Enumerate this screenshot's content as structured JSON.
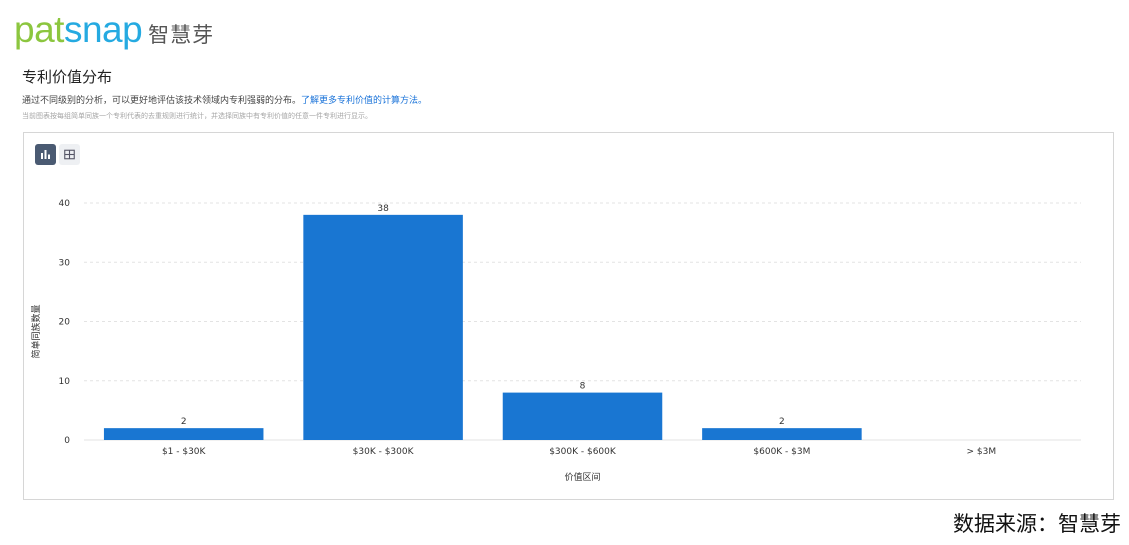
{
  "logo": {
    "word_a": "pat",
    "word_b": "snap",
    "cn": "智慧芽"
  },
  "header": {
    "title": "专利价值分布",
    "description": "通过不同级别的分析，可以更好地评估该技术领域内专利强弱的分布。",
    "description_link": "了解更多专利价值的计算方法。",
    "note": "当前图表按每组简单同族一个专利代表的去重规则进行统计，并选择同族中有专利价值的任意一件专利进行显示。"
  },
  "toolbar": {
    "chart_view": "bar-chart-icon",
    "table_view": "table-grid-icon",
    "active": "chart"
  },
  "colors": {
    "bar": "#1976d2",
    "grid": "#e3e3e3",
    "active_btn": "#4a5a72"
  },
  "chart_data": {
    "type": "bar",
    "categories": [
      "$1 - $30K",
      "$30K - $300K",
      "$300K - $600K",
      "$600K - $3M",
      "> $3M"
    ],
    "values": [
      2,
      38,
      8,
      2,
      0
    ],
    "data_labels": [
      "2",
      "38",
      "8",
      "2",
      ""
    ],
    "xlabel": "价值区间",
    "ylabel": "简单同族数量",
    "ylim": [
      0,
      40
    ],
    "yticks": [
      0,
      10,
      20,
      30,
      40
    ],
    "grid": true,
    "grid_style": "dashed"
  },
  "footer": {
    "source": "数据来源：智慧芽"
  }
}
